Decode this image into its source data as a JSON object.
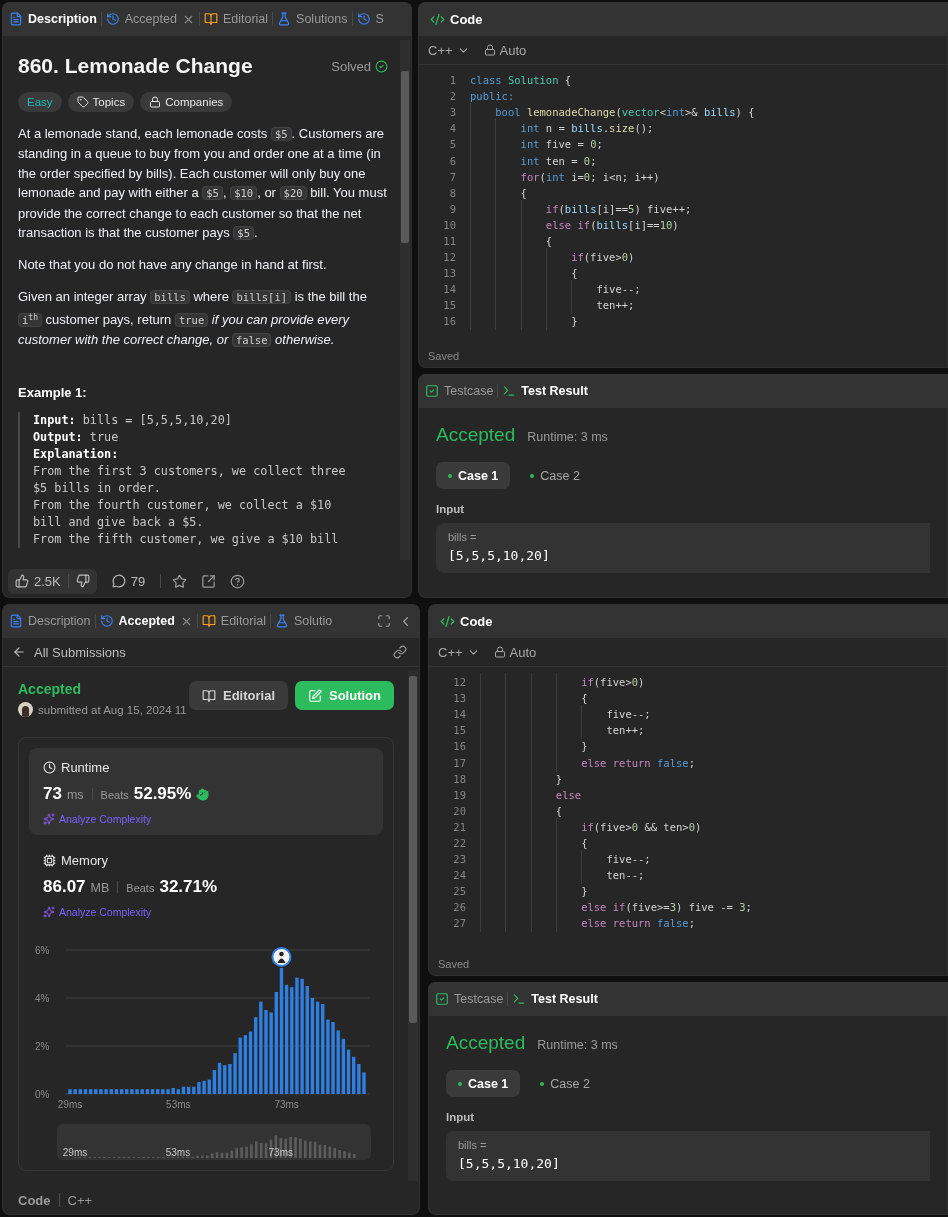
{
  "problem_panel": {
    "tabs": [
      {
        "label": "Description",
        "kind": "doc",
        "selected": true,
        "closable": false
      },
      {
        "label": "Accepted",
        "kind": "history",
        "selected": false,
        "closable": true
      },
      {
        "label": "Editorial",
        "kind": "book",
        "selected": false,
        "closable": false
      },
      {
        "label": "Solutions",
        "kind": "flask",
        "selected": false,
        "closable": false
      },
      {
        "label": "S",
        "kind": "history",
        "selected": false,
        "closable": false
      }
    ],
    "title": "860. Lemonade Change",
    "status": "Solved",
    "tags": [
      {
        "label": "Easy",
        "kind": "difficulty"
      },
      {
        "label": "Topics",
        "kind": "tag"
      },
      {
        "label": "Companies",
        "kind": "lock"
      }
    ],
    "paragraphs": [
      [
        {
          "text": "At a lemonade stand, each lemonade costs ",
          "kind": "text"
        },
        {
          "text": "$5",
          "kind": "code"
        },
        {
          "text": ". Customers are standing in a queue to buy from you and order one at a time (in the order specified by bills). Each customer will only buy one lemonade and pay with either a ",
          "kind": "text"
        },
        {
          "text": "$5",
          "kind": "code"
        },
        {
          "text": ", ",
          "kind": "text"
        },
        {
          "text": "$10",
          "kind": "code"
        },
        {
          "text": ", or ",
          "kind": "text"
        },
        {
          "text": "$20",
          "kind": "code"
        },
        {
          "text": " bill. You must provide the correct change to each customer so that the net transaction is that the customer pays ",
          "kind": "text"
        },
        {
          "text": "$5",
          "kind": "code"
        },
        {
          "text": ".",
          "kind": "text"
        }
      ],
      [
        {
          "text": "Note that you do not have any change in hand at first.",
          "kind": "text"
        }
      ],
      [
        {
          "text": "Given an integer array ",
          "kind": "text"
        },
        {
          "text": "bills",
          "kind": "code"
        },
        {
          "text": " where ",
          "kind": "text"
        },
        {
          "text": "bills[i]",
          "kind": "code"
        },
        {
          "text": " is the bill the ",
          "kind": "text"
        },
        {
          "text": "i$^{th}$",
          "kind": "code"
        },
        {
          "text": " customer pays, return ",
          "kind": "text"
        },
        {
          "text": "true",
          "kind": "code"
        },
        {
          "text": " if you can provide every customer with the correct change, or ",
          "kind": "italic"
        },
        {
          "text": "false",
          "kind": "code"
        },
        {
          "text": " otherwise.",
          "kind": "italic"
        }
      ]
    ],
    "example_heading": "Example 1:",
    "example_lines": [
      {
        "text": "**Input:** bills = [5,5,5,10,20]",
        "kind": "text"
      },
      {
        "text": "**Output:** true",
        "kind": "text"
      },
      {
        "text": "Explanation:",
        "kind": "label"
      },
      {
        "text": "From the first 3 customers, we collect three",
        "kind": "text"
      },
      {
        "text": "$5 bills in order.",
        "kind": "text"
      },
      {
        "text": "From the fourth customer, we collect a $10",
        "kind": "text"
      },
      {
        "text": "bill and give back a $5.",
        "kind": "text"
      },
      {
        "text": "From the fifth customer, we give a $10 bill",
        "kind": "text"
      }
    ],
    "footer": {
      "likes": "2.5K",
      "comments": "79"
    }
  },
  "top_right": {
    "editor": {
      "title": "Code",
      "language": "C++",
      "mode": "Auto",
      "status": "Saved",
      "lines": [
        {
          "number": "1",
          "tokens": [
            {
              "text": "class",
              "kind": "type"
            },
            {
              "text": " Solution",
              "kind": "class"
            },
            {
              "text": " {"
            }
          ]
        },
        {
          "number": "2",
          "tokens": [
            {
              "text": "public:",
              "kind": "type"
            }
          ]
        },
        {
          "number": "3",
          "tokens": [
            {
              "text": "    bool",
              "kind": "type"
            },
            {
              "text": " lemonadeChange",
              "kind": "function"
            },
            {
              "text": "("
            },
            {
              "text": "vector",
              "kind": "class"
            },
            {
              "text": "<"
            },
            {
              "text": "int",
              "kind": "type"
            },
            {
              "text": ">& "
            },
            {
              "text": "bills",
              "kind": "variable"
            },
            {
              "text": ") {"
            }
          ]
        },
        {
          "number": "4",
          "tokens": [
            {
              "text": "        int",
              "kind": "type"
            },
            {
              "text": " n = "
            },
            {
              "text": "bills",
              "kind": "variable"
            },
            {
              "text": "."
            },
            {
              "text": "size",
              "kind": "function"
            },
            {
              "text": "();"
            }
          ]
        },
        {
          "number": "5",
          "tokens": [
            {
              "text": "        int",
              "kind": "type"
            },
            {
              "text": " five = "
            },
            {
              "text": "0",
              "kind": "number"
            },
            {
              "text": ";"
            }
          ]
        },
        {
          "number": "6",
          "tokens": [
            {
              "text": "        int",
              "kind": "type"
            },
            {
              "text": " ten = "
            },
            {
              "text": "0",
              "kind": "number"
            },
            {
              "text": ";"
            }
          ]
        },
        {
          "number": "7",
          "tokens": [
            {
              "text": "        for",
              "kind": "keyword"
            },
            {
              "text": "("
            },
            {
              "text": "int",
              "kind": "type"
            },
            {
              "text": " i="
            },
            {
              "text": "0",
              "kind": "number"
            },
            {
              "text": "; i<n; i++)"
            }
          ]
        },
        {
          "number": "8",
          "tokens": [
            {
              "text": "        {"
            }
          ]
        },
        {
          "number": "9",
          "tokens": [
            {
              "text": "            if",
              "kind": "keyword"
            },
            {
              "text": "("
            },
            {
              "text": "bills",
              "kind": "variable"
            },
            {
              "text": "[i]=="
            },
            {
              "text": "5",
              "kind": "number"
            },
            {
              "text": ") five++;"
            }
          ]
        },
        {
          "number": "10",
          "tokens": [
            {
              "text": "            else",
              "kind": "keyword"
            },
            {
              "text": " if",
              "kind": "keyword"
            },
            {
              "text": "("
            },
            {
              "text": "bills",
              "kind": "variable"
            },
            {
              "text": "[i]=="
            },
            {
              "text": "10",
              "kind": "number"
            },
            {
              "text": ")"
            }
          ]
        },
        {
          "number": "11",
          "tokens": [
            {
              "text": "            {"
            }
          ]
        },
        {
          "number": "12",
          "tokens": [
            {
              "text": "                if",
              "kind": "keyword"
            },
            {
              "text": "(five>"
            },
            {
              "text": "0",
              "kind": "number"
            },
            {
              "text": ")"
            }
          ]
        },
        {
          "number": "13",
          "tokens": [
            {
              "text": "                {"
            }
          ]
        },
        {
          "number": "14",
          "tokens": [
            {
              "text": "                    five--;"
            }
          ]
        },
        {
          "number": "15",
          "tokens": [
            {
              "text": "                    ten++;"
            }
          ]
        },
        {
          "number": "16",
          "tokens": [
            {
              "text": "                }"
            }
          ]
        }
      ]
    },
    "test_result": {
      "tabs": [
        {
          "label": "Testcase",
          "kind": "checkbox",
          "selected": false
        },
        {
          "label": "Test Result",
          "kind": "terminal",
          "selected": true
        }
      ],
      "verdict": "Accepted",
      "runtime": "Runtime: 3 ms",
      "cases": [
        {
          "label": "Case 1",
          "selected": true
        },
        {
          "label": "Case 2",
          "selected": false
        }
      ],
      "input_label": "Input",
      "variable": "bills =",
      "value": "[5,5,5,10,20]"
    }
  },
  "submission_panel": {
    "tabs": [
      {
        "label": "Description",
        "kind": "doc",
        "selected": false,
        "closable": false
      },
      {
        "label": "Accepted",
        "kind": "history",
        "selected": true,
        "closable": true
      },
      {
        "label": "Editorial",
        "kind": "book",
        "selected": false,
        "closable": false
      },
      {
        "label": "Solutio",
        "kind": "flask",
        "selected": false,
        "closable": false
      }
    ],
    "back_label": "All Submissions",
    "verdict": "Accepted",
    "submitted": "submitted at Aug 15, 2024 11",
    "buttons": [
      {
        "label": "Editorial",
        "kind": "book"
      },
      {
        "label": "Solution",
        "kind": "pen"
      }
    ],
    "metrics": [
      {
        "kind": "clock",
        "label": "Runtime",
        "value": "73",
        "unit": "ms",
        "beats_label": "Beats",
        "beats": "52.95%",
        "celebrate": true,
        "action": "Analyze Complexity",
        "selected": true
      },
      {
        "kind": "chip",
        "label": "Memory",
        "value": "86.07",
        "unit": "MB",
        "beats_label": "Beats",
        "beats": "32.71%",
        "celebrate": false,
        "action": "Analyze Complexity",
        "selected": false
      }
    ],
    "chart_data": {
      "type": "bar",
      "categories": [
        "29ms",
        null,
        null,
        null,
        null,
        null,
        null,
        null,
        null,
        null,
        null,
        null,
        null,
        null,
        null,
        null,
        null,
        null,
        null,
        null,
        null,
        "53ms",
        null,
        null,
        null,
        null,
        null,
        null,
        null,
        null,
        null,
        null,
        null,
        null,
        null,
        null,
        null,
        null,
        null,
        null,
        null,
        null,
        "73ms",
        null,
        null,
        null,
        null,
        null,
        null,
        null,
        null,
        null,
        null,
        null,
        null,
        null,
        null,
        null
      ],
      "values": [
        0.2,
        0.2,
        0.2,
        0.2,
        0.2,
        0.2,
        0.2,
        0.2,
        0.2,
        0.2,
        0.2,
        0.2,
        0.2,
        0.2,
        0.2,
        0.2,
        0.2,
        0.2,
        0.2,
        0.2,
        0.25,
        0.2,
        0.3,
        0.3,
        0.3,
        0.5,
        0.55,
        0.6,
        1.0,
        1.3,
        1.2,
        1.25,
        1.7,
        2.35,
        2.45,
        2.6,
        3.2,
        3.85,
        3.5,
        3.4,
        4.25,
        5.25,
        4.55,
        4.45,
        4.85,
        4.8,
        4.5,
        4.0,
        3.85,
        3.75,
        3.1,
        3.0,
        2.65,
        2.3,
        1.85,
        1.55,
        1.25,
        0.9
      ],
      "ylim": [
        0,
        6
      ],
      "yticks": [
        {
          "value": 0,
          "label": "0%"
        },
        {
          "value": 2,
          "label": "2%"
        },
        {
          "value": 4,
          "label": "4%"
        },
        {
          "value": 6,
          "label": "6%"
        }
      ]
    },
    "overview_labels": [
      "29ms",
      "53ms",
      "73ms"
    ],
    "footer": [
      "Code",
      "C++"
    ]
  },
  "bottom_right": {
    "editor": {
      "title": "Code",
      "language": "C++",
      "mode": "Auto",
      "status": "Saved",
      "lines": [
        {
          "number": "12",
          "tokens": [
            {
              "text": "                if",
              "kind": "keyword"
            },
            {
              "text": "(five>"
            },
            {
              "text": "0",
              "kind": "number"
            },
            {
              "text": ")"
            }
          ]
        },
        {
          "number": "13",
          "tokens": [
            {
              "text": "                {"
            }
          ]
        },
        {
          "number": "14",
          "tokens": [
            {
              "text": "                    five--;"
            }
          ]
        },
        {
          "number": "15",
          "tokens": [
            {
              "text": "                    ten++;"
            }
          ]
        },
        {
          "number": "16",
          "tokens": [
            {
              "text": "                }"
            }
          ]
        },
        {
          "number": "17",
          "tokens": [
            {
              "text": "                else",
              "kind": "keyword"
            },
            {
              "text": " return",
              "kind": "keyword"
            },
            {
              "text": " false",
              "kind": "type"
            },
            {
              "text": ";"
            }
          ]
        },
        {
          "number": "18",
          "tokens": [
            {
              "text": "            }"
            }
          ]
        },
        {
          "number": "19",
          "tokens": [
            {
              "text": "            else",
              "kind": "keyword"
            }
          ]
        },
        {
          "number": "20",
          "tokens": [
            {
              "text": "            {"
            }
          ]
        },
        {
          "number": "21",
          "tokens": [
            {
              "text": "                if",
              "kind": "keyword"
            },
            {
              "text": "(five>"
            },
            {
              "text": "0",
              "kind": "number"
            },
            {
              "text": " && ten>"
            },
            {
              "text": "0",
              "kind": "number"
            },
            {
              "text": ")"
            }
          ]
        },
        {
          "number": "22",
          "tokens": [
            {
              "text": "                {"
            }
          ]
        },
        {
          "number": "23",
          "tokens": [
            {
              "text": "                    five--;"
            }
          ]
        },
        {
          "number": "24",
          "tokens": [
            {
              "text": "                    ten--;"
            }
          ]
        },
        {
          "number": "25",
          "tokens": [
            {
              "text": "                }"
            }
          ]
        },
        {
          "number": "26",
          "tokens": [
            {
              "text": "                else",
              "kind": "keyword"
            },
            {
              "text": " if",
              "kind": "keyword"
            },
            {
              "text": "(five>="
            },
            {
              "text": "3",
              "kind": "number"
            },
            {
              "text": ") five -= "
            },
            {
              "text": "3",
              "kind": "number"
            },
            {
              "text": ";"
            }
          ]
        },
        {
          "number": "27",
          "tokens": [
            {
              "text": "                else",
              "kind": "keyword"
            },
            {
              "text": " return",
              "kind": "keyword"
            },
            {
              "text": " false",
              "kind": "type"
            },
            {
              "text": ";"
            }
          ]
        }
      ]
    },
    "test_result": {
      "tabs": [
        {
          "label": "Testcase",
          "kind": "checkbox",
          "selected": false
        },
        {
          "label": "Test Result",
          "kind": "terminal",
          "selected": true
        }
      ],
      "verdict": "Accepted",
      "runtime": "Runtime: 3 ms",
      "cases": [
        {
          "label": "Case 1",
          "selected": true
        },
        {
          "label": "Case 2",
          "selected": false
        }
      ],
      "input_label": "Input",
      "variable": "bills =",
      "value": "[5,5,5,10,20]"
    }
  }
}
